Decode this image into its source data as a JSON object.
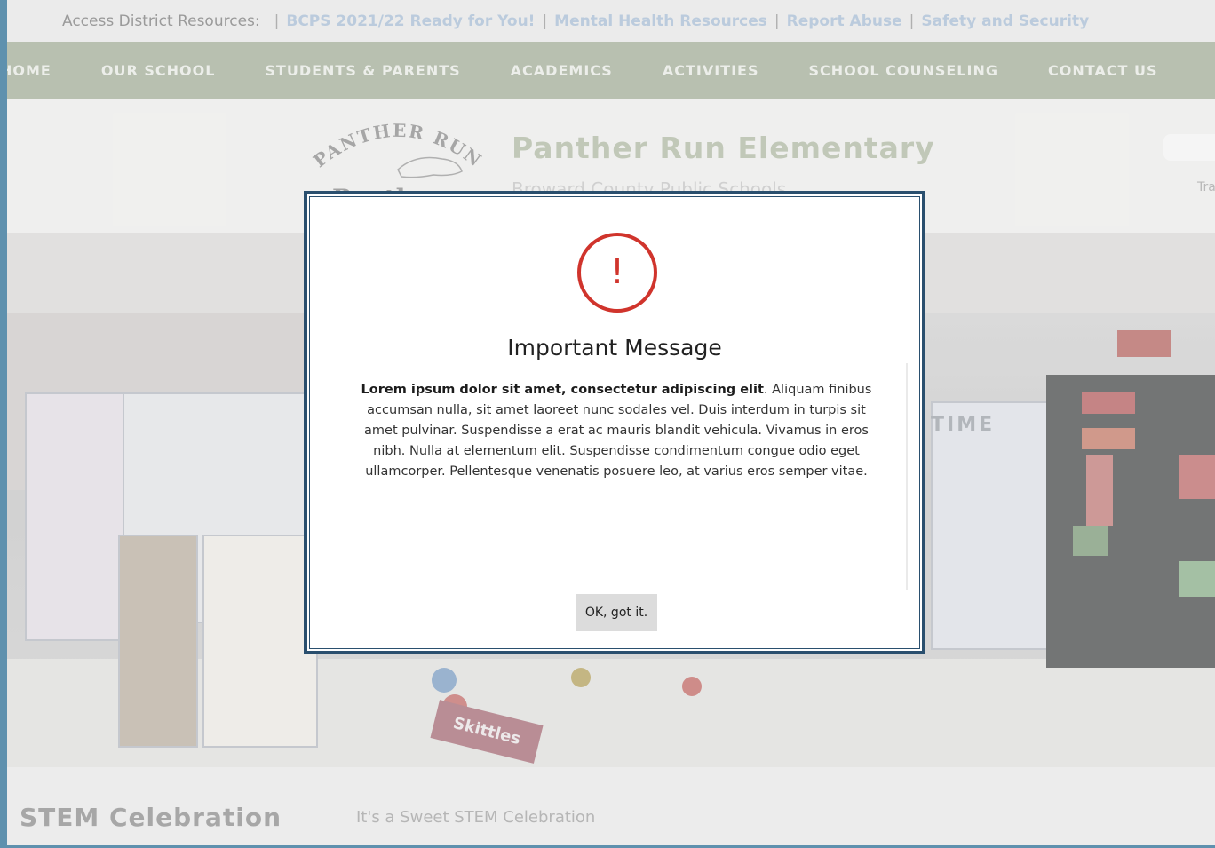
{
  "utility_bar": {
    "lead": "Access District Resources:",
    "links": [
      "BCPS 2021/22 Ready for You!",
      "Mental Health Resources",
      "Report Abuse",
      "Safety and Security"
    ]
  },
  "nav": {
    "items": [
      "HOME",
      "OUR SCHOOL",
      "STUDENTS & PARENTS",
      "ACADEMICS",
      "ACTIVITIES",
      "SCHOOL COUNSELING",
      "CONTACT US"
    ]
  },
  "header": {
    "logo_arc_text": "PANTHER RUN",
    "logo_word": "Panthers",
    "school_name": "Panther Run Elementary",
    "district": "Broward County Public Schools",
    "translate_label": "Tra"
  },
  "hero": {
    "board_text_time": "TIME",
    "skittles_label": "Skittles"
  },
  "caption": {
    "title": "STEM Celebration",
    "subtitle": "It's a Sweet STEM Celebration"
  },
  "modal": {
    "icon": "exclamation-alert-icon",
    "icon_glyph": "!",
    "icon_color": "#d0342c",
    "title": "Important Message",
    "body_bold": "Lorem ipsum dolor sit amet, consectetur adipiscing elit",
    "body_rest": ". Aliquam finibus accumsan nulla, sit amet laoreet nunc sodales vel. Duis interdum in turpis sit amet pulvinar. Suspendisse a erat ac mauris blandit vehicula. Vivamus in eros nibh. Nulla at elementum elit. Suspendisse condimentum congue odio eget ullamcorper. Pellentesque venenatis posuere leo, at varius eros semper vitae.",
    "ok_label": "OK, got it."
  }
}
